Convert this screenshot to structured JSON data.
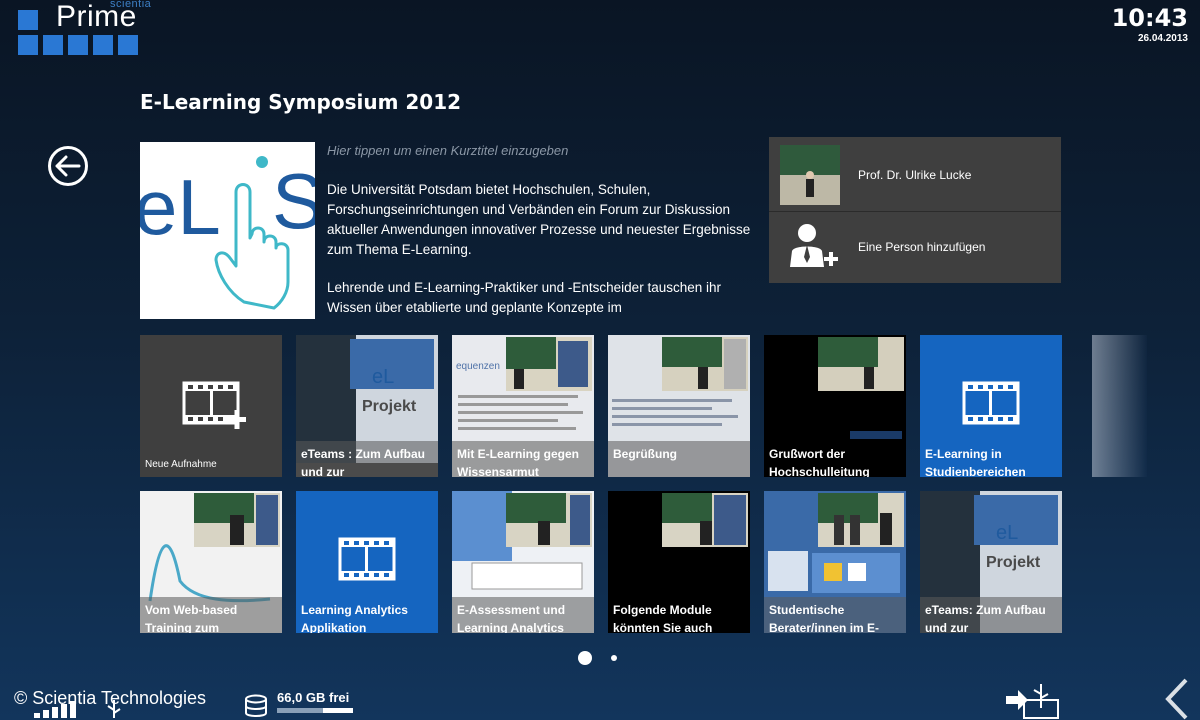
{
  "logo": {
    "small": "scientia",
    "big": "Prime"
  },
  "clock": {
    "time": "10:43",
    "date": "26.04.2013"
  },
  "page_title": "E-Learning Symposium 2012",
  "description": {
    "hint": "Hier tippen um einen Kurztitel einzugeben",
    "paragraph1": "Die Universität Potsdam bietet Hochschulen, Schulen, Forschungseinrichtungen und Verbänden ein Forum zur Diskussion aktueller Anwendungen innovativer Prozesse und neuester Ergebnisse zum Thema E-Learning.",
    "paragraph2": "Lehrende und E-Learning-Praktiker und -Entscheider tauschen ihr Wissen über etablierte und geplante Konzepte im"
  },
  "hero_logo_text": "eLiS",
  "persons": [
    {
      "label": "Prof. Dr. Ulrike Lucke"
    },
    {
      "label": "Eine Person hinzufügen"
    }
  ],
  "tiles_row1": [
    {
      "caption": "Neue Aufnahme",
      "kind": "new"
    },
    {
      "caption": "eTeams : Zum Aufbau und zur",
      "kind": "video"
    },
    {
      "caption": "Mit E-Learning gegen Wissensarmut",
      "kind": "video"
    },
    {
      "caption": "Begrüßung",
      "kind": "video"
    },
    {
      "caption": "Grußwort der Hochschulleitung",
      "kind": "video"
    },
    {
      "caption": "E-Learning in Studienbereichen",
      "kind": "film"
    }
  ],
  "tiles_row2": [
    {
      "caption": "Vom Web-based Training zum",
      "kind": "video"
    },
    {
      "caption": "Learning Analytics Applikation",
      "kind": "film"
    },
    {
      "caption": "E-Assessment und Learning Analytics",
      "kind": "video"
    },
    {
      "caption": "Folgende Module könnten Sie auch",
      "kind": "video"
    },
    {
      "caption": "Studentische Berater/innen im E-",
      "kind": "video"
    },
    {
      "caption": "eTeams: Zum Aufbau und zur",
      "kind": "video"
    }
  ],
  "pager": {
    "pages": 2,
    "current": 1
  },
  "status": {
    "copyright": "© Scientia Technologies",
    "storage": "66,0 GB frei",
    "storage_used_fraction": 0.6
  },
  "colors": {
    "accent_blue": "#1565c0",
    "tile_dark": "#3f3f3f",
    "logo_blue": "#2a78d4"
  }
}
